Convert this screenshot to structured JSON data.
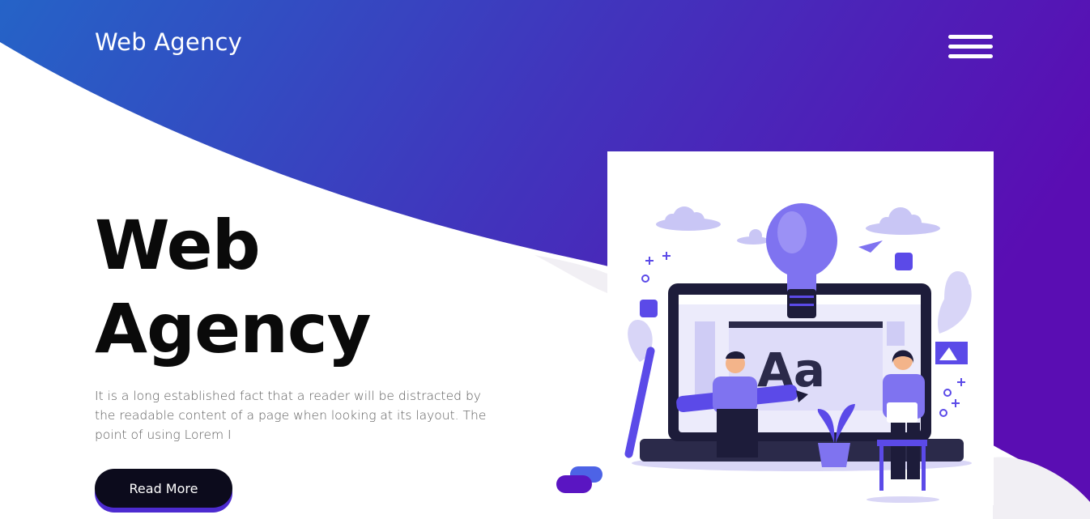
{
  "brand": {
    "name": "Web Agency"
  },
  "nav": {
    "menu_icon": "hamburger-menu-icon"
  },
  "hero": {
    "title_line1": "Web",
    "title_line2": "Agency",
    "description": "It is a long established fact that a reader will be distracted by the readable content of a page when looking at its layout. The point of using Lorem I",
    "cta_label": "Read More",
    "illustration_text": "Aa"
  },
  "colors": {
    "gradient_start": "#2563c7",
    "gradient_end": "#5a0db3",
    "accent": "#5b4ae8",
    "dark": "#0c0b1c"
  }
}
